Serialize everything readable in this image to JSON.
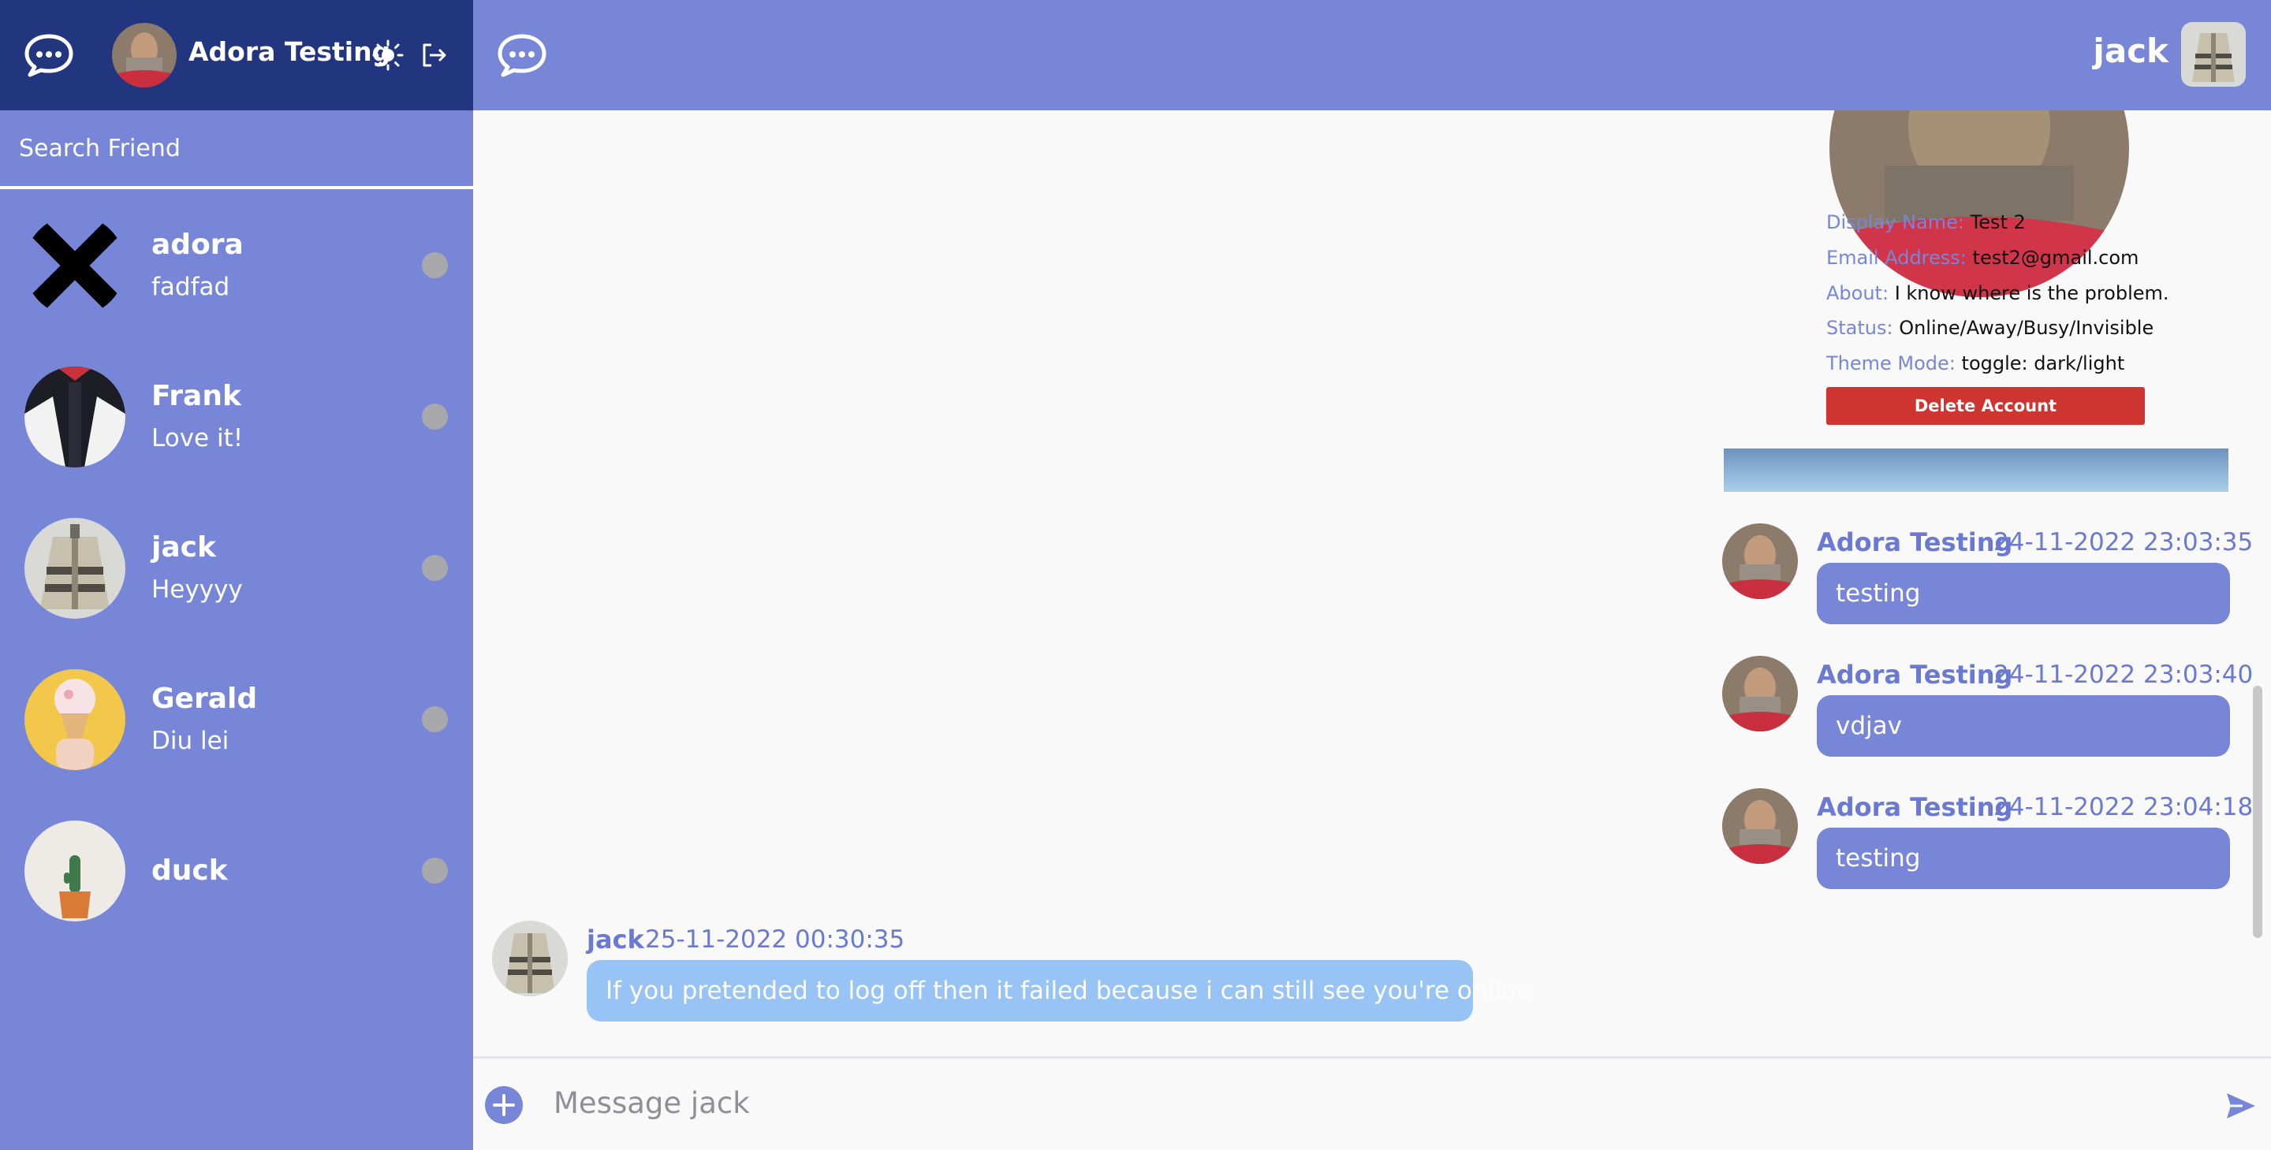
{
  "sidebar": {
    "user": {
      "name": "Adora Testing"
    },
    "search": {
      "placeholder": "Search Friend"
    },
    "friends": [
      {
        "name": "adora",
        "last_message": "fadfad",
        "status": "offline"
      },
      {
        "name": "Frank",
        "last_message": "Love it!",
        "status": "offline"
      },
      {
        "name": "jack",
        "last_message": "Heyyyy",
        "status": "offline"
      },
      {
        "name": "Gerald",
        "last_message": "Diu lei",
        "status": "offline"
      },
      {
        "name": "duck",
        "last_message": "",
        "status": "offline"
      }
    ]
  },
  "header": {
    "peer_name": "jack"
  },
  "profile": {
    "fields": [
      {
        "key": "Display Name:",
        "value": "Test 2"
      },
      {
        "key": "Email Address:",
        "value": "test2@gmail.com"
      },
      {
        "key": "About:",
        "value": "I know where is the problem."
      },
      {
        "key": "Status:",
        "value": "Online/Away/Busy/Invisible"
      },
      {
        "key": "Theme Mode:",
        "value": "toggle: dark/light"
      }
    ],
    "delete_label": "Delete Account"
  },
  "messages": [
    {
      "sender": "Adora Testing",
      "time": "24-11-2022 23:03:35",
      "text": "testing",
      "mine": true
    },
    {
      "sender": "Adora Testing",
      "time": "24-11-2022 23:03:40",
      "text": "vdjav",
      "mine": true
    },
    {
      "sender": "Adora Testing",
      "time": "24-11-2022 23:04:18",
      "text": "testing",
      "mine": true
    },
    {
      "sender": "jack",
      "time": "25-11-2022 00:30:35",
      "text": "If you pretended to log off then it failed because i can still see you're online",
      "mine": false
    }
  ],
  "composer": {
    "placeholder": "Message jack"
  },
  "icons": {
    "logo": "chat-bubble-icon",
    "theme": "sun-icon",
    "logout": "logout-icon",
    "add": "plus-circle-icon",
    "send": "send-icon"
  },
  "colors": {
    "sidebar_header": "#22357f",
    "accent": "#7886d7",
    "incoming_bubble": "#98c4f5",
    "danger": "#cf3530",
    "status_dot": "#a9a9ad"
  }
}
